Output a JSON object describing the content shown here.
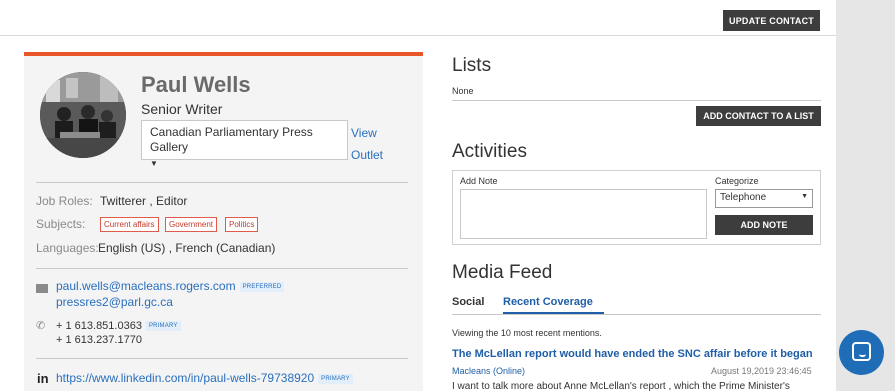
{
  "header": {
    "update_button": "UPDATE CONTACT"
  },
  "profile": {
    "name": "Paul Wells",
    "title": "Senior Writer",
    "outlet": "Canadian Parliamentary Press Gallery",
    "view_outlet": "View Outlet"
  },
  "details": {
    "job_roles_label": "Job Roles:",
    "job_roles_value": "Twitterer , Editor",
    "subjects_label": "Subjects:",
    "subjects": [
      "Current affairs",
      "Government",
      "Politics"
    ],
    "languages_label": "Languages:",
    "languages_value": "English (US) , French (Canadian)"
  },
  "contact": {
    "email_primary": "paul.wells@macleans.rogers.com",
    "email_badge": "PREFERRED",
    "email_secondary": "pressres2@parl.gc.ca",
    "phone_primary": "+ 1 613.851.0363",
    "phone_badge": "PRIMARY",
    "phone_secondary": "+ 1 613.237.1770",
    "linkedin": "https://www.linkedin.com/in/paul-wells-79738920",
    "linkedin_badge": "PRIMARY",
    "linkedin_icon": "in"
  },
  "lists": {
    "heading": "Lists",
    "value": "None",
    "add_button": "ADD CONTACT TO A LIST"
  },
  "activities": {
    "heading": "Activities",
    "add_note_label": "Add Note",
    "categorize_label": "Categorize",
    "categorize_value": "Telephone",
    "add_note_button": "ADD NOTE"
  },
  "media_feed": {
    "heading": "Media Feed",
    "tabs": [
      "Social",
      "Recent Coverage"
    ],
    "active_tab": "Recent Coverage",
    "viewing_text": "Viewing the 10 most recent mentions.",
    "article_title": "The McLellan report would have ended the SNC affair before it began",
    "article_source": "Macleans (Online)",
    "article_date": "August 19,2019 23:46:45",
    "article_snippet": "I want to talk more about Anne McLellan's report , which the Prime Minister's"
  },
  "colors": {
    "accent": "#e8562a",
    "link": "#2a6fbd",
    "dark_button": "#3d3d3d",
    "chat": "#1f6db6"
  }
}
